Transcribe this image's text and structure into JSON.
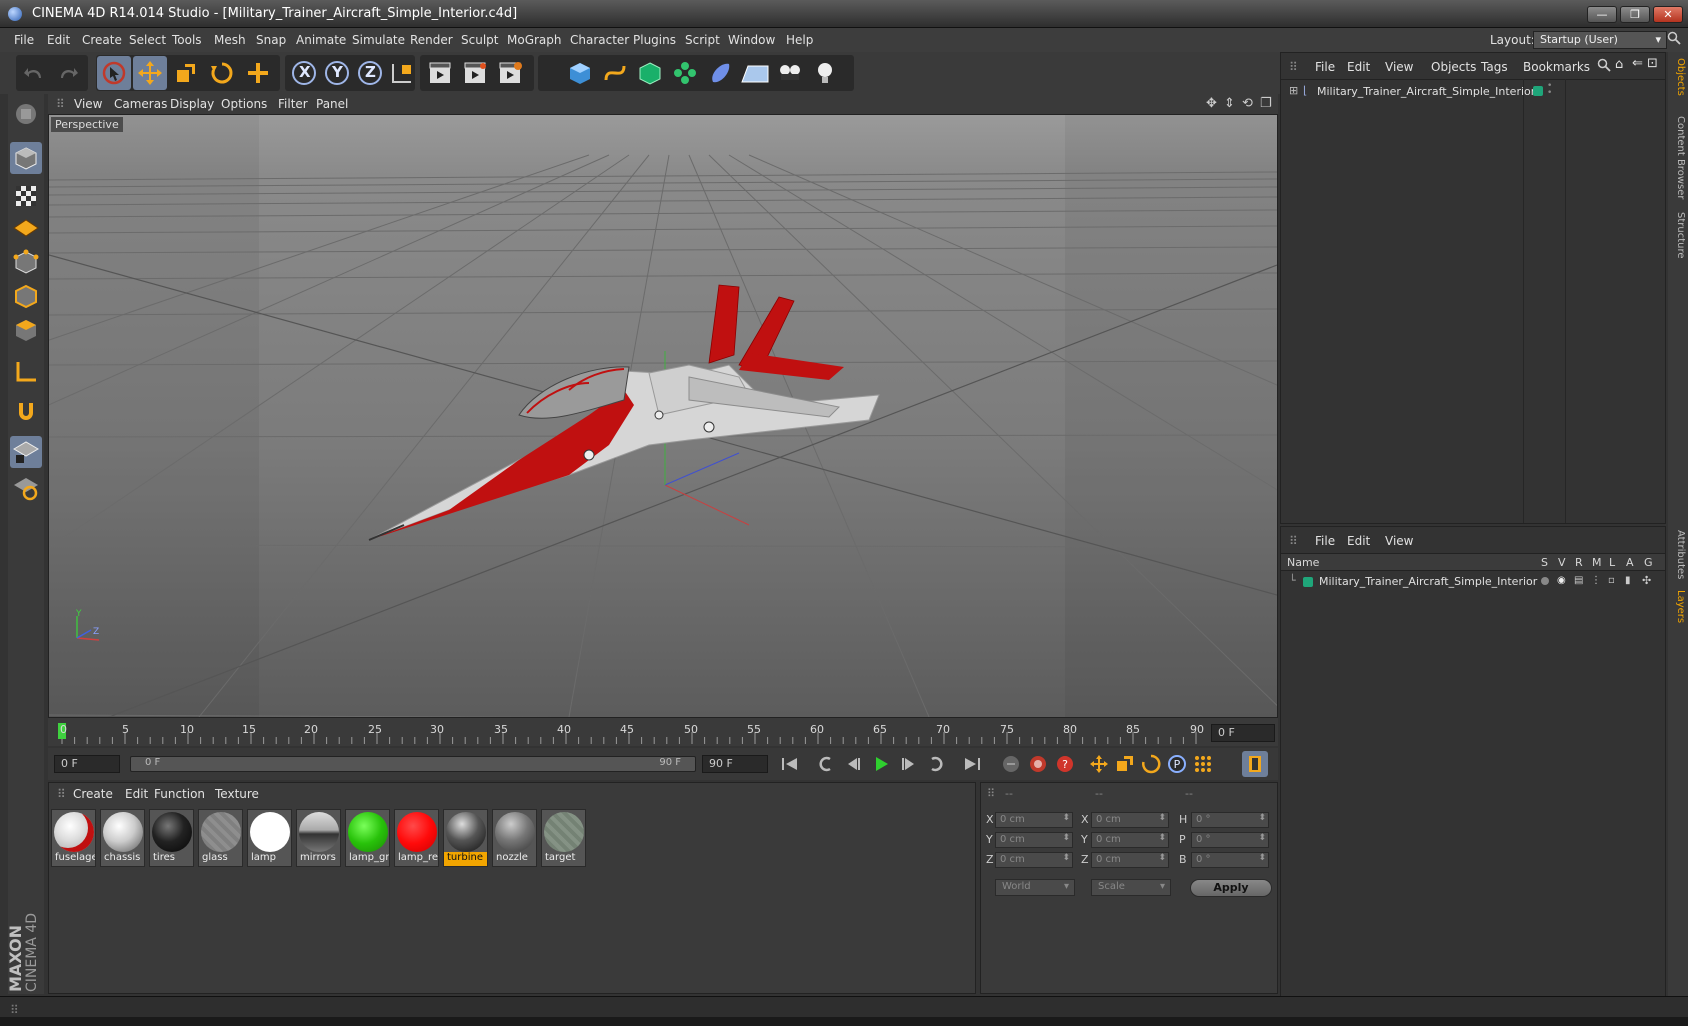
{
  "title_bar": {
    "title": "CINEMA 4D R14.014 Studio - [Military_Trainer_Aircraft_Simple_Interior.c4d]",
    "minimize": "—",
    "maximize": "❐",
    "close": "✕"
  },
  "menu": {
    "items": [
      "File",
      "Edit",
      "Create",
      "Select",
      "Tools",
      "Mesh",
      "Snap",
      "Animate",
      "Simulate",
      "Render",
      "Sculpt",
      "MoGraph",
      "Character",
      "Plugins",
      "Script",
      "Window",
      "Help"
    ],
    "layout_label": "Layout:",
    "layout_value": "Startup (User)"
  },
  "toolbar": {
    "axis_x": "X",
    "axis_y": "Y",
    "axis_z": "Z"
  },
  "viewport": {
    "menu": [
      "View",
      "Cameras",
      "Display",
      "Options",
      "Filter",
      "Panel"
    ],
    "label": "Perspective",
    "axis_y": "Y",
    "axis_z": "Z"
  },
  "timeline": {
    "ticks": [
      "0",
      "5",
      "10",
      "15",
      "20",
      "25",
      "30",
      "35",
      "40",
      "45",
      "50",
      "55",
      "60",
      "65",
      "70",
      "75",
      "80",
      "85",
      "90"
    ],
    "current_frame": "0 F",
    "current_progress": 0.0
  },
  "transport": {
    "start_frame": "0 F",
    "range_start": "0 F",
    "range_end": "90 F",
    "end_frame": "90 F"
  },
  "materials": {
    "menu": [
      "Create",
      "Edit",
      "Function",
      "Texture"
    ],
    "items": [
      {
        "label": "fuselage",
        "selected": false
      },
      {
        "label": "chassis",
        "selected": false
      },
      {
        "label": "tires",
        "selected": false
      },
      {
        "label": "glass",
        "selected": false
      },
      {
        "label": "lamp",
        "selected": false
      },
      {
        "label": "mirrors",
        "selected": false
      },
      {
        "label": "lamp_gr",
        "selected": false
      },
      {
        "label": "lamp_re",
        "selected": false
      },
      {
        "label": "turbine",
        "selected": true
      },
      {
        "label": "nozzle",
        "selected": false
      },
      {
        "label": "target",
        "selected": false
      }
    ]
  },
  "coordinates": {
    "headers": [
      "--",
      "--",
      "--"
    ],
    "pos_labels": [
      "X",
      "Y",
      "Z"
    ],
    "pos_values": [
      "0 cm",
      "0 cm",
      "0 cm"
    ],
    "size_labels": [
      "X",
      "Y",
      "Z"
    ],
    "size_values": [
      "0 cm",
      "0 cm",
      "0 cm"
    ],
    "rot_labels": [
      "H",
      "P",
      "B"
    ],
    "rot_values": [
      "0 °",
      "0 °",
      "0 °"
    ],
    "mode": "World",
    "size_mode": "Scale",
    "apply": "Apply"
  },
  "objects_panel": {
    "menu": [
      "File",
      "Edit",
      "View",
      "Objects",
      "Tags",
      "Bookmarks"
    ],
    "object_name": "Military_Trainer_Aircraft_Simple_Interior"
  },
  "layers_panel": {
    "menu": [
      "File",
      "Edit",
      "View"
    ],
    "columns": [
      "Name",
      "S",
      "V",
      "R",
      "M",
      "L",
      "A",
      "G"
    ],
    "layer_name": "Military_Trainer_Aircraft_Simple_Interior"
  },
  "right_tabs": [
    "Objects",
    "Content Browser",
    "Structure",
    "Attributes",
    "Layers"
  ],
  "branding": {
    "maxon": "MAXON",
    "product": "CINEMA 4D"
  },
  "colors": {
    "accent_selected": "#f2a500",
    "active_tool": "#6e7f9a",
    "aircraft_red": "#c01010",
    "layer_color": "#1fa67a"
  }
}
